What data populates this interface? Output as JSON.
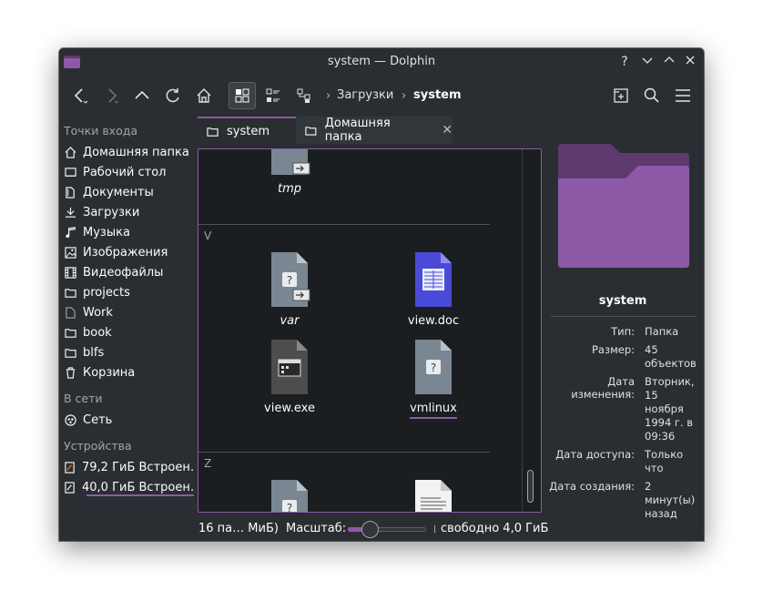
{
  "window": {
    "title": "system — Dolphin"
  },
  "titlebar": {
    "help": "?",
    "minimize": "⌄",
    "maximize": "⌃",
    "close": "✕"
  },
  "breadcrumb": {
    "parent": "Загрузки",
    "current": "system"
  },
  "sidebar": {
    "places_header": "Точки входа",
    "places": [
      {
        "label": "Домашняя папка",
        "icon": "home-icon"
      },
      {
        "label": "Рабочий стол",
        "icon": "desktop-icon"
      },
      {
        "label": "Документы",
        "icon": "documents-icon"
      },
      {
        "label": "Загрузки",
        "icon": "download-icon"
      },
      {
        "label": "Музыка",
        "icon": "music-icon"
      },
      {
        "label": "Изображения",
        "icon": "image-icon"
      },
      {
        "label": "Видеофайлы",
        "icon": "video-icon"
      },
      {
        "label": "projects",
        "icon": "folder-icon"
      },
      {
        "label": "Work",
        "icon": "document-icon"
      },
      {
        "label": "book",
        "icon": "folder-icon"
      },
      {
        "label": "blfs",
        "icon": "folder-icon"
      },
      {
        "label": "Корзина",
        "icon": "trash-icon"
      }
    ],
    "network_header": "В сети",
    "network": [
      {
        "label": "Сеть",
        "icon": "network-icon"
      }
    ],
    "devices_header": "Устройства",
    "devices": [
      {
        "label": "79,2 ГиБ Встроен…",
        "icon": "drive-icon"
      },
      {
        "label": "40,0 ГиБ Встроен…",
        "icon": "drive-icon",
        "usage_fraction": 1.0
      }
    ]
  },
  "tabs": [
    {
      "label": "system",
      "active": true
    },
    {
      "label": "Домашняя папка",
      "active": false
    }
  ],
  "view": {
    "groups": [
      {
        "letter": "V"
      },
      {
        "letter": "Z"
      }
    ],
    "files": [
      {
        "name": "tmp",
        "kind": "symlink-unknown",
        "italic": true
      },
      {
        "name": "var",
        "kind": "symlink-unknown",
        "italic": true
      },
      {
        "name": "view.doc",
        "kind": "document",
        "italic": false
      },
      {
        "name": "view.exe",
        "kind": "executable",
        "italic": false
      },
      {
        "name": "vmlinux",
        "kind": "unknown",
        "italic": false,
        "selected": true
      },
      {
        "name": "",
        "kind": "unknown"
      },
      {
        "name": "",
        "kind": "text"
      }
    ]
  },
  "info_panel": {
    "name": "system",
    "rows": [
      {
        "label": "Тип:",
        "value": "Папка"
      },
      {
        "label": "Размер:",
        "value": "45 объектов"
      },
      {
        "label": "Дата изменения:",
        "value": "Вторник, 15 ноября 1994 г. в 09:36"
      },
      {
        "label": "Дата доступа:",
        "value": "Только что"
      },
      {
        "label": "Дата создания:",
        "value": "2 минут(ы) назад"
      }
    ],
    "folder_color": "#8e5aa8"
  },
  "status": {
    "summary": "16 па… МиБ)",
    "zoom_label": "Масштаб:",
    "free": "свободно 4,0 ГиБ"
  },
  "colors": {
    "accent": "#8e5aa8",
    "background": "#2a2e32",
    "view_bg": "#1b1e20"
  }
}
